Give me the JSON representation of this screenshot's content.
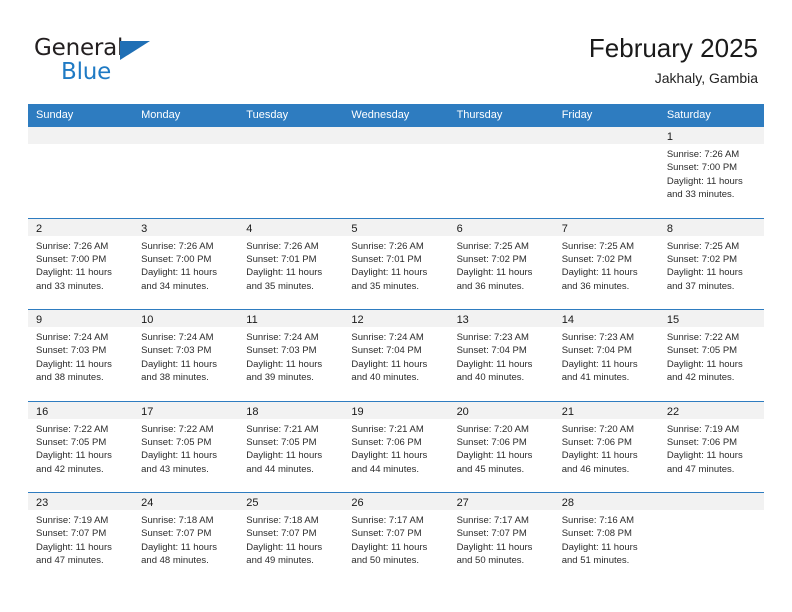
{
  "brand": {
    "name_top": "General",
    "name_bottom": "Blue",
    "accent_color": "#1f7ac4",
    "triangle_icon": "brand-triangle-icon"
  },
  "header": {
    "title": "February 2025",
    "subtitle": "Jakhaly, Gambia"
  },
  "theme": {
    "header_bar": "#2e7cc0",
    "day_band": "#f2f2f2",
    "text": "#1a1a1a"
  },
  "weekdays": [
    "Sunday",
    "Monday",
    "Tuesday",
    "Wednesday",
    "Thursday",
    "Friday",
    "Saturday"
  ],
  "labels": {
    "sunrise": "Sunrise:",
    "sunset": "Sunset:",
    "daylight": "Daylight:"
  },
  "weeks": [
    [
      {
        "day": "",
        "sunrise": "",
        "sunset": "",
        "daylight_line1": "",
        "daylight_line2": ""
      },
      {
        "day": "",
        "sunrise": "",
        "sunset": "",
        "daylight_line1": "",
        "daylight_line2": ""
      },
      {
        "day": "",
        "sunrise": "",
        "sunset": "",
        "daylight_line1": "",
        "daylight_line2": ""
      },
      {
        "day": "",
        "sunrise": "",
        "sunset": "",
        "daylight_line1": "",
        "daylight_line2": ""
      },
      {
        "day": "",
        "sunrise": "",
        "sunset": "",
        "daylight_line1": "",
        "daylight_line2": ""
      },
      {
        "day": "",
        "sunrise": "",
        "sunset": "",
        "daylight_line1": "",
        "daylight_line2": ""
      },
      {
        "day": "1",
        "sunrise": "Sunrise: 7:26 AM",
        "sunset": "Sunset: 7:00 PM",
        "daylight_line1": "Daylight: 11 hours",
        "daylight_line2": "and 33 minutes."
      }
    ],
    [
      {
        "day": "2",
        "sunrise": "Sunrise: 7:26 AM",
        "sunset": "Sunset: 7:00 PM",
        "daylight_line1": "Daylight: 11 hours",
        "daylight_line2": "and 33 minutes."
      },
      {
        "day": "3",
        "sunrise": "Sunrise: 7:26 AM",
        "sunset": "Sunset: 7:00 PM",
        "daylight_line1": "Daylight: 11 hours",
        "daylight_line2": "and 34 minutes."
      },
      {
        "day": "4",
        "sunrise": "Sunrise: 7:26 AM",
        "sunset": "Sunset: 7:01 PM",
        "daylight_line1": "Daylight: 11 hours",
        "daylight_line2": "and 35 minutes."
      },
      {
        "day": "5",
        "sunrise": "Sunrise: 7:26 AM",
        "sunset": "Sunset: 7:01 PM",
        "daylight_line1": "Daylight: 11 hours",
        "daylight_line2": "and 35 minutes."
      },
      {
        "day": "6",
        "sunrise": "Sunrise: 7:25 AM",
        "sunset": "Sunset: 7:02 PM",
        "daylight_line1": "Daylight: 11 hours",
        "daylight_line2": "and 36 minutes."
      },
      {
        "day": "7",
        "sunrise": "Sunrise: 7:25 AM",
        "sunset": "Sunset: 7:02 PM",
        "daylight_line1": "Daylight: 11 hours",
        "daylight_line2": "and 36 minutes."
      },
      {
        "day": "8",
        "sunrise": "Sunrise: 7:25 AM",
        "sunset": "Sunset: 7:02 PM",
        "daylight_line1": "Daylight: 11 hours",
        "daylight_line2": "and 37 minutes."
      }
    ],
    [
      {
        "day": "9",
        "sunrise": "Sunrise: 7:24 AM",
        "sunset": "Sunset: 7:03 PM",
        "daylight_line1": "Daylight: 11 hours",
        "daylight_line2": "and 38 minutes."
      },
      {
        "day": "10",
        "sunrise": "Sunrise: 7:24 AM",
        "sunset": "Sunset: 7:03 PM",
        "daylight_line1": "Daylight: 11 hours",
        "daylight_line2": "and 38 minutes."
      },
      {
        "day": "11",
        "sunrise": "Sunrise: 7:24 AM",
        "sunset": "Sunset: 7:03 PM",
        "daylight_line1": "Daylight: 11 hours",
        "daylight_line2": "and 39 minutes."
      },
      {
        "day": "12",
        "sunrise": "Sunrise: 7:24 AM",
        "sunset": "Sunset: 7:04 PM",
        "daylight_line1": "Daylight: 11 hours",
        "daylight_line2": "and 40 minutes."
      },
      {
        "day": "13",
        "sunrise": "Sunrise: 7:23 AM",
        "sunset": "Sunset: 7:04 PM",
        "daylight_line1": "Daylight: 11 hours",
        "daylight_line2": "and 40 minutes."
      },
      {
        "day": "14",
        "sunrise": "Sunrise: 7:23 AM",
        "sunset": "Sunset: 7:04 PM",
        "daylight_line1": "Daylight: 11 hours",
        "daylight_line2": "and 41 minutes."
      },
      {
        "day": "15",
        "sunrise": "Sunrise: 7:22 AM",
        "sunset": "Sunset: 7:05 PM",
        "daylight_line1": "Daylight: 11 hours",
        "daylight_line2": "and 42 minutes."
      }
    ],
    [
      {
        "day": "16",
        "sunrise": "Sunrise: 7:22 AM",
        "sunset": "Sunset: 7:05 PM",
        "daylight_line1": "Daylight: 11 hours",
        "daylight_line2": "and 42 minutes."
      },
      {
        "day": "17",
        "sunrise": "Sunrise: 7:22 AM",
        "sunset": "Sunset: 7:05 PM",
        "daylight_line1": "Daylight: 11 hours",
        "daylight_line2": "and 43 minutes."
      },
      {
        "day": "18",
        "sunrise": "Sunrise: 7:21 AM",
        "sunset": "Sunset: 7:05 PM",
        "daylight_line1": "Daylight: 11 hours",
        "daylight_line2": "and 44 minutes."
      },
      {
        "day": "19",
        "sunrise": "Sunrise: 7:21 AM",
        "sunset": "Sunset: 7:06 PM",
        "daylight_line1": "Daylight: 11 hours",
        "daylight_line2": "and 44 minutes."
      },
      {
        "day": "20",
        "sunrise": "Sunrise: 7:20 AM",
        "sunset": "Sunset: 7:06 PM",
        "daylight_line1": "Daylight: 11 hours",
        "daylight_line2": "and 45 minutes."
      },
      {
        "day": "21",
        "sunrise": "Sunrise: 7:20 AM",
        "sunset": "Sunset: 7:06 PM",
        "daylight_line1": "Daylight: 11 hours",
        "daylight_line2": "and 46 minutes."
      },
      {
        "day": "22",
        "sunrise": "Sunrise: 7:19 AM",
        "sunset": "Sunset: 7:06 PM",
        "daylight_line1": "Daylight: 11 hours",
        "daylight_line2": "and 47 minutes."
      }
    ],
    [
      {
        "day": "23",
        "sunrise": "Sunrise: 7:19 AM",
        "sunset": "Sunset: 7:07 PM",
        "daylight_line1": "Daylight: 11 hours",
        "daylight_line2": "and 47 minutes."
      },
      {
        "day": "24",
        "sunrise": "Sunrise: 7:18 AM",
        "sunset": "Sunset: 7:07 PM",
        "daylight_line1": "Daylight: 11 hours",
        "daylight_line2": "and 48 minutes."
      },
      {
        "day": "25",
        "sunrise": "Sunrise: 7:18 AM",
        "sunset": "Sunset: 7:07 PM",
        "daylight_line1": "Daylight: 11 hours",
        "daylight_line2": "and 49 minutes."
      },
      {
        "day": "26",
        "sunrise": "Sunrise: 7:17 AM",
        "sunset": "Sunset: 7:07 PM",
        "daylight_line1": "Daylight: 11 hours",
        "daylight_line2": "and 50 minutes."
      },
      {
        "day": "27",
        "sunrise": "Sunrise: 7:17 AM",
        "sunset": "Sunset: 7:07 PM",
        "daylight_line1": "Daylight: 11 hours",
        "daylight_line2": "and 50 minutes."
      },
      {
        "day": "28",
        "sunrise": "Sunrise: 7:16 AM",
        "sunset": "Sunset: 7:08 PM",
        "daylight_line1": "Daylight: 11 hours",
        "daylight_line2": "and 51 minutes."
      },
      {
        "day": "",
        "sunrise": "",
        "sunset": "",
        "daylight_line1": "",
        "daylight_line2": ""
      }
    ]
  ]
}
